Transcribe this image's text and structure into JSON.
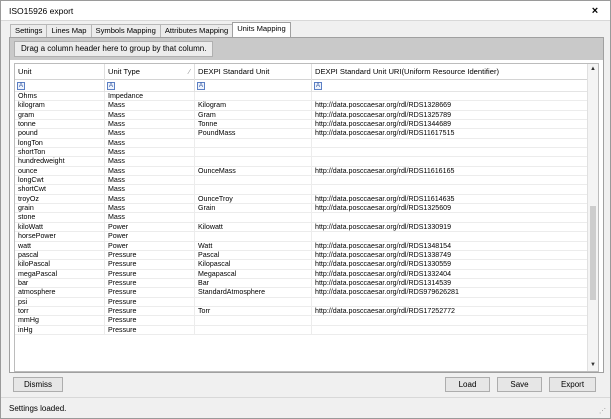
{
  "window": {
    "title": "ISO15926 export",
    "close_icon": "×"
  },
  "tabs": [
    {
      "label": "Settings"
    },
    {
      "label": "Lines Map"
    },
    {
      "label": "Symbols Mapping"
    },
    {
      "label": "Attributes Mapping"
    },
    {
      "label": "Units Mapping",
      "active": true
    }
  ],
  "group_panel": {
    "hint": "Drag a column header here to group by that column."
  },
  "grid": {
    "columns": [
      "Unit",
      "Unit Type",
      "DEXPI Standard Unit",
      "DEXPI Standard Unit URI(Uniform Resource Identifier)"
    ],
    "filter_icon": "A",
    "rows": [
      [
        "Ohms",
        "Impedance",
        "",
        ""
      ],
      [
        "kilogram",
        "Mass",
        "Kilogram",
        "http://data.posccaesar.org/rdl/RDS1328669"
      ],
      [
        "gram",
        "Mass",
        "Gram",
        "http://data.posccaesar.org/rdl/RDS1325789"
      ],
      [
        "tonne",
        "Mass",
        "Tonne",
        "http://data.posccaesar.org/rdl/RDS1344689"
      ],
      [
        "pound",
        "Mass",
        "PoundMass",
        "http://data.posccaesar.org/rdl/RDS11617515"
      ],
      [
        "longTon",
        "Mass",
        "",
        ""
      ],
      [
        "shortTon",
        "Mass",
        "",
        ""
      ],
      [
        "hundredweight",
        "Mass",
        "",
        ""
      ],
      [
        "ounce",
        "Mass",
        "OunceMass",
        "http://data.posccaesar.org/rdl/RDS11616165"
      ],
      [
        "longCwt",
        "Mass",
        "",
        ""
      ],
      [
        "shortCwt",
        "Mass",
        "",
        ""
      ],
      [
        "troyOz",
        "Mass",
        "OunceTroy",
        "http://data.posccaesar.org/rdl/RDS11614635"
      ],
      [
        "grain",
        "Mass",
        "Grain",
        "http://data.posccaesar.org/rdl/RDS1325609"
      ],
      [
        "stone",
        "Mass",
        "",
        ""
      ],
      [
        "kiloWatt",
        "Power",
        "Kilowatt",
        "http://data.posccaesar.org/rdl/RDS1330919"
      ],
      [
        "horsePower",
        "Power",
        "",
        ""
      ],
      [
        "watt",
        "Power",
        "Watt",
        "http://data.posccaesar.org/rdl/RDS1348154"
      ],
      [
        "pascal",
        "Pressure",
        "Pascal",
        "http://data.posccaesar.org/rdl/RDS1338749"
      ],
      [
        "kiloPascal",
        "Pressure",
        "Kilopascal",
        "http://data.posccaesar.org/rdl/RDS1330559"
      ],
      [
        "megaPascal",
        "Pressure",
        "Megapascal",
        "http://data.posccaesar.org/rdl/RDS1332404"
      ],
      [
        "bar",
        "Pressure",
        "Bar",
        "http://data.posccaesar.org/rdl/RDS1314539"
      ],
      [
        "atmosphere",
        "Pressure",
        "StandardAtmosphere",
        "http://data.posccaesar.org/rdl/RDS979626281"
      ],
      [
        "psi",
        "Pressure",
        "",
        ""
      ],
      [
        "torr",
        "Pressure",
        "Torr",
        "http://data.posccaesar.org/rdl/RDS17252772"
      ],
      [
        "mmHg",
        "Pressure",
        "",
        ""
      ],
      [
        "inHg",
        "Pressure",
        "",
        ""
      ]
    ],
    "scroll_up_icon": "▲",
    "scroll_down_icon": "▼"
  },
  "buttons": {
    "dismiss": "Dismiss",
    "load": "Load",
    "save": "Save",
    "export": "Export"
  },
  "status": {
    "text": "Settings loaded."
  },
  "colors": {
    "group_panel_bg": "#c9c9c9",
    "filter_icon_accent": "#5b7fc4"
  }
}
